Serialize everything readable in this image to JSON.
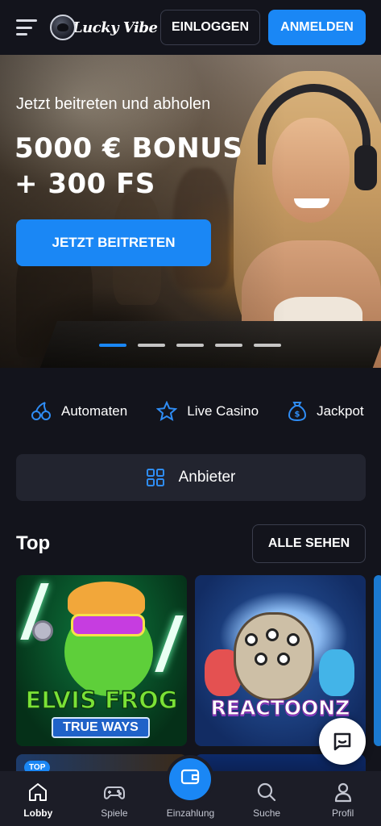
{
  "header": {
    "logo_text": "Lucky Vibe",
    "login_label": "EINLOGGEN",
    "signup_label": "ANMELDEN"
  },
  "hero": {
    "subtitle": "Jetzt beitreten und abholen",
    "title_line1": "5000 € BONUS",
    "title_line2": "+ 300 FS",
    "cta_label": "JETZT BEITRETEN",
    "slides_total": 5,
    "active_slide": 1
  },
  "categories": [
    {
      "label": "Automaten",
      "icon": "cherry-icon"
    },
    {
      "label": "Live Casino",
      "icon": "star-icon"
    },
    {
      "label": "Jackpot",
      "icon": "money-bag-icon"
    }
  ],
  "provider": {
    "label": "Anbieter",
    "icon": "grid-icon"
  },
  "top_section": {
    "title": "Top",
    "see_all_label": "ALLE SEHEN",
    "games": [
      {
        "title": "ELVIS FROG",
        "subtitle": "TRUE WAYS"
      },
      {
        "title": "REACTOONZ"
      }
    ],
    "badge": "TOP"
  },
  "bottom_nav": {
    "items": [
      {
        "label": "Lobby",
        "icon": "home-icon",
        "active": true
      },
      {
        "label": "Spiele",
        "icon": "gamepad-icon",
        "active": false
      },
      {
        "label": "Einzahlung",
        "icon": "wallet-icon",
        "active": false
      },
      {
        "label": "Suche",
        "icon": "search-icon",
        "active": false
      },
      {
        "label": "Profil",
        "icon": "user-icon",
        "active": false
      }
    ]
  },
  "colors": {
    "background": "#13141c",
    "accent": "#1a87f5",
    "card": "#22242f",
    "nav": "#1c1d27"
  }
}
